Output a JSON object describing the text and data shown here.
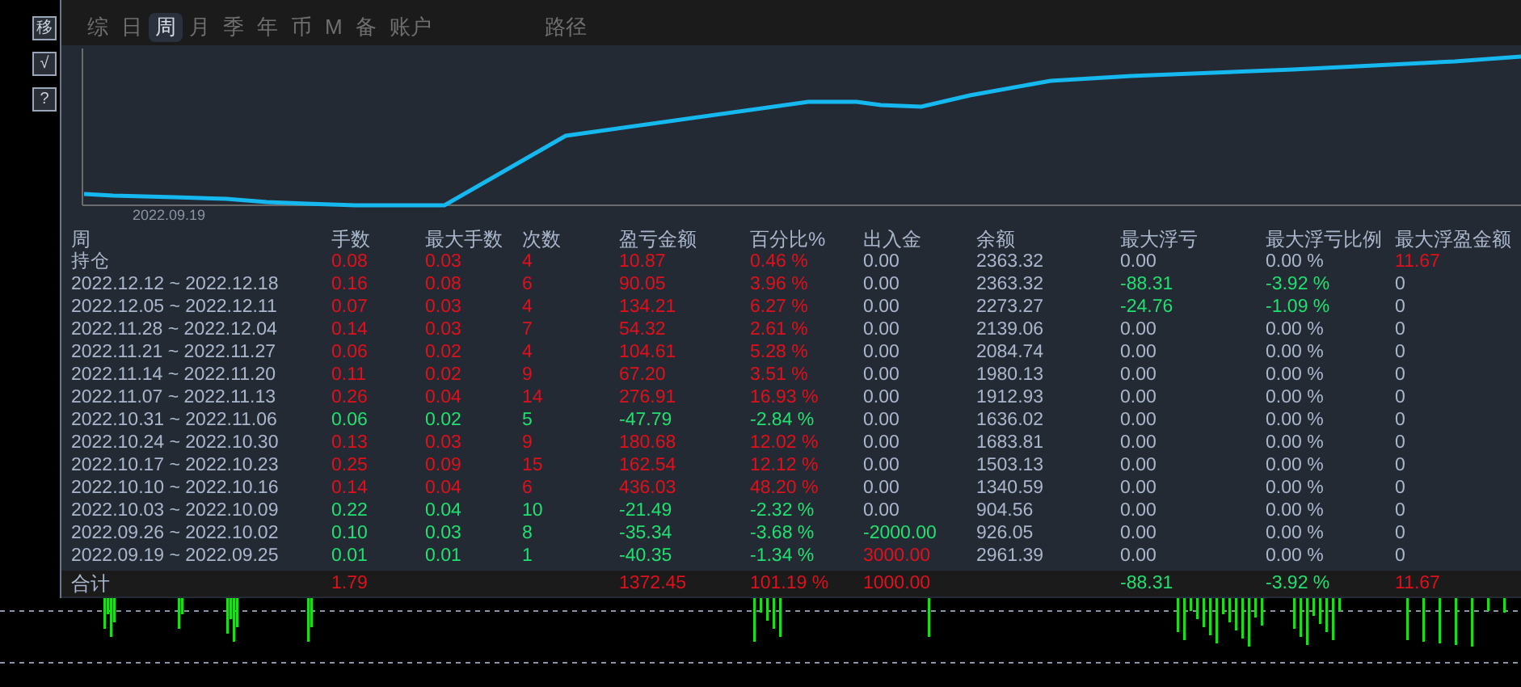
{
  "side_buttons": [
    "移",
    "√",
    "?"
  ],
  "tabs": [
    {
      "label": "综",
      "kind": "view",
      "selected": false
    },
    {
      "label": "日",
      "kind": "view",
      "selected": false
    },
    {
      "label": "周",
      "kind": "view",
      "selected": true
    },
    {
      "label": "月",
      "kind": "view",
      "selected": false
    },
    {
      "label": "季",
      "kind": "view",
      "selected": false
    },
    {
      "label": "年",
      "kind": "view",
      "selected": false
    },
    {
      "label": "币",
      "kind": "view",
      "selected": false
    },
    {
      "label": "M",
      "kind": "view",
      "selected": false
    },
    {
      "label": "备",
      "kind": "view",
      "selected": false
    },
    {
      "label": "账户",
      "kind": "view",
      "selected": false
    },
    {
      "label": "路径",
      "kind": "route",
      "selected": false
    }
  ],
  "equity_chart": {
    "date_label": "2022.09.19"
  },
  "table": {
    "period_header": "周",
    "columns": [
      "手数",
      "最大手数",
      "次数",
      "盈亏金额",
      "百分比%",
      "出入金",
      "余额",
      "最大浮亏",
      "最大浮亏比例",
      "最大浮盈金额"
    ],
    "rows": [
      {
        "period": "持仓",
        "cells": [
          {
            "text": "0.08",
            "color": "#e0101c"
          },
          {
            "text": "0.03",
            "color": "#e0101c"
          },
          {
            "text": "4",
            "color": "#e0101c"
          },
          {
            "text": "10.87",
            "color": "#e0101c"
          },
          {
            "text": "0.46 %",
            "color": "#e0101c"
          },
          {
            "text": "0.00",
            "color": "#a9b6cc"
          },
          {
            "text": "2363.32",
            "color": "#a9b6cc"
          },
          {
            "text": "0.00",
            "color": "#a9b6cc"
          },
          {
            "text": "0.00 %",
            "color": "#a9b6cc"
          },
          {
            "text": "11.67",
            "color": "#e0101c"
          }
        ]
      },
      {
        "period": "2022.12.12 ~ 2022.12.18",
        "cells": [
          {
            "text": "0.16",
            "color": "#e0101c"
          },
          {
            "text": "0.08",
            "color": "#e0101c"
          },
          {
            "text": "6",
            "color": "#e0101c"
          },
          {
            "text": "90.05",
            "color": "#e0101c"
          },
          {
            "text": "3.96 %",
            "color": "#e0101c"
          },
          {
            "text": "0.00",
            "color": "#a9b6cc"
          },
          {
            "text": "2363.32",
            "color": "#a9b6cc"
          },
          {
            "text": "-88.31",
            "color": "#1fe070"
          },
          {
            "text": "-3.92 %",
            "color": "#1fe070"
          },
          {
            "text": "0",
            "color": "#a9b6cc"
          }
        ]
      },
      {
        "period": "2022.12.05 ~ 2022.12.11",
        "cells": [
          {
            "text": "0.07",
            "color": "#e0101c"
          },
          {
            "text": "0.03",
            "color": "#e0101c"
          },
          {
            "text": "4",
            "color": "#e0101c"
          },
          {
            "text": "134.21",
            "color": "#e0101c"
          },
          {
            "text": "6.27 %",
            "color": "#e0101c"
          },
          {
            "text": "0.00",
            "color": "#a9b6cc"
          },
          {
            "text": "2273.27",
            "color": "#a9b6cc"
          },
          {
            "text": "-24.76",
            "color": "#1fe070"
          },
          {
            "text": "-1.09 %",
            "color": "#1fe070"
          },
          {
            "text": "0",
            "color": "#a9b6cc"
          }
        ]
      },
      {
        "period": "2022.11.28 ~ 2022.12.04",
        "cells": [
          {
            "text": "0.14",
            "color": "#e0101c"
          },
          {
            "text": "0.03",
            "color": "#e0101c"
          },
          {
            "text": "7",
            "color": "#e0101c"
          },
          {
            "text": "54.32",
            "color": "#e0101c"
          },
          {
            "text": "2.61 %",
            "color": "#e0101c"
          },
          {
            "text": "0.00",
            "color": "#a9b6cc"
          },
          {
            "text": "2139.06",
            "color": "#a9b6cc"
          },
          {
            "text": "0.00",
            "color": "#a9b6cc"
          },
          {
            "text": "0.00 %",
            "color": "#a9b6cc"
          },
          {
            "text": "0",
            "color": "#a9b6cc"
          }
        ]
      },
      {
        "period": "2022.11.21 ~ 2022.11.27",
        "cells": [
          {
            "text": "0.06",
            "color": "#e0101c"
          },
          {
            "text": "0.02",
            "color": "#e0101c"
          },
          {
            "text": "4",
            "color": "#e0101c"
          },
          {
            "text": "104.61",
            "color": "#e0101c"
          },
          {
            "text": "5.28 %",
            "color": "#e0101c"
          },
          {
            "text": "0.00",
            "color": "#a9b6cc"
          },
          {
            "text": "2084.74",
            "color": "#a9b6cc"
          },
          {
            "text": "0.00",
            "color": "#a9b6cc"
          },
          {
            "text": "0.00 %",
            "color": "#a9b6cc"
          },
          {
            "text": "0",
            "color": "#a9b6cc"
          }
        ]
      },
      {
        "period": "2022.11.14 ~ 2022.11.20",
        "cells": [
          {
            "text": "0.11",
            "color": "#e0101c"
          },
          {
            "text": "0.02",
            "color": "#e0101c"
          },
          {
            "text": "9",
            "color": "#e0101c"
          },
          {
            "text": "67.20",
            "color": "#e0101c"
          },
          {
            "text": "3.51 %",
            "color": "#e0101c"
          },
          {
            "text": "0.00",
            "color": "#a9b6cc"
          },
          {
            "text": "1980.13",
            "color": "#a9b6cc"
          },
          {
            "text": "0.00",
            "color": "#a9b6cc"
          },
          {
            "text": "0.00 %",
            "color": "#a9b6cc"
          },
          {
            "text": "0",
            "color": "#a9b6cc"
          }
        ]
      },
      {
        "period": "2022.11.07 ~ 2022.11.13",
        "cells": [
          {
            "text": "0.26",
            "color": "#e0101c"
          },
          {
            "text": "0.04",
            "color": "#e0101c"
          },
          {
            "text": "14",
            "color": "#e0101c"
          },
          {
            "text": "276.91",
            "color": "#e0101c"
          },
          {
            "text": "16.93 %",
            "color": "#e0101c"
          },
          {
            "text": "0.00",
            "color": "#a9b6cc"
          },
          {
            "text": "1912.93",
            "color": "#a9b6cc"
          },
          {
            "text": "0.00",
            "color": "#a9b6cc"
          },
          {
            "text": "0.00 %",
            "color": "#a9b6cc"
          },
          {
            "text": "0",
            "color": "#a9b6cc"
          }
        ]
      },
      {
        "period": "2022.10.31 ~ 2022.11.06",
        "cells": [
          {
            "text": "0.06",
            "color": "#1fe070"
          },
          {
            "text": "0.02",
            "color": "#1fe070"
          },
          {
            "text": "5",
            "color": "#1fe070"
          },
          {
            "text": "-47.79",
            "color": "#1fe070"
          },
          {
            "text": "-2.84 %",
            "color": "#1fe070"
          },
          {
            "text": "0.00",
            "color": "#a9b6cc"
          },
          {
            "text": "1636.02",
            "color": "#a9b6cc"
          },
          {
            "text": "0.00",
            "color": "#a9b6cc"
          },
          {
            "text": "0.00 %",
            "color": "#a9b6cc"
          },
          {
            "text": "0",
            "color": "#a9b6cc"
          }
        ]
      },
      {
        "period": "2022.10.24 ~ 2022.10.30",
        "cells": [
          {
            "text": "0.13",
            "color": "#e0101c"
          },
          {
            "text": "0.03",
            "color": "#e0101c"
          },
          {
            "text": "9",
            "color": "#e0101c"
          },
          {
            "text": "180.68",
            "color": "#e0101c"
          },
          {
            "text": "12.02 %",
            "color": "#e0101c"
          },
          {
            "text": "0.00",
            "color": "#a9b6cc"
          },
          {
            "text": "1683.81",
            "color": "#a9b6cc"
          },
          {
            "text": "0.00",
            "color": "#a9b6cc"
          },
          {
            "text": "0.00 %",
            "color": "#a9b6cc"
          },
          {
            "text": "0",
            "color": "#a9b6cc"
          }
        ]
      },
      {
        "period": "2022.10.17 ~ 2022.10.23",
        "cells": [
          {
            "text": "0.25",
            "color": "#e0101c"
          },
          {
            "text": "0.09",
            "color": "#e0101c"
          },
          {
            "text": "15",
            "color": "#e0101c"
          },
          {
            "text": "162.54",
            "color": "#e0101c"
          },
          {
            "text": "12.12 %",
            "color": "#e0101c"
          },
          {
            "text": "0.00",
            "color": "#a9b6cc"
          },
          {
            "text": "1503.13",
            "color": "#a9b6cc"
          },
          {
            "text": "0.00",
            "color": "#a9b6cc"
          },
          {
            "text": "0.00 %",
            "color": "#a9b6cc"
          },
          {
            "text": "0",
            "color": "#a9b6cc"
          }
        ]
      },
      {
        "period": "2022.10.10 ~ 2022.10.16",
        "cells": [
          {
            "text": "0.14",
            "color": "#e0101c"
          },
          {
            "text": "0.04",
            "color": "#e0101c"
          },
          {
            "text": "6",
            "color": "#e0101c"
          },
          {
            "text": "436.03",
            "color": "#e0101c"
          },
          {
            "text": "48.20 %",
            "color": "#e0101c"
          },
          {
            "text": "0.00",
            "color": "#a9b6cc"
          },
          {
            "text": "1340.59",
            "color": "#a9b6cc"
          },
          {
            "text": "0.00",
            "color": "#a9b6cc"
          },
          {
            "text": "0.00 %",
            "color": "#a9b6cc"
          },
          {
            "text": "0",
            "color": "#a9b6cc"
          }
        ]
      },
      {
        "period": "2022.10.03 ~ 2022.10.09",
        "cells": [
          {
            "text": "0.22",
            "color": "#1fe070"
          },
          {
            "text": "0.04",
            "color": "#1fe070"
          },
          {
            "text": "10",
            "color": "#1fe070"
          },
          {
            "text": "-21.49",
            "color": "#1fe070"
          },
          {
            "text": "-2.32 %",
            "color": "#1fe070"
          },
          {
            "text": "0.00",
            "color": "#a9b6cc"
          },
          {
            "text": "904.56",
            "color": "#a9b6cc"
          },
          {
            "text": "0.00",
            "color": "#a9b6cc"
          },
          {
            "text": "0.00 %",
            "color": "#a9b6cc"
          },
          {
            "text": "0",
            "color": "#a9b6cc"
          }
        ]
      },
      {
        "period": "2022.09.26 ~ 2022.10.02",
        "cells": [
          {
            "text": "0.10",
            "color": "#1fe070"
          },
          {
            "text": "0.03",
            "color": "#1fe070"
          },
          {
            "text": "8",
            "color": "#1fe070"
          },
          {
            "text": "-35.34",
            "color": "#1fe070"
          },
          {
            "text": "-3.68 %",
            "color": "#1fe070"
          },
          {
            "text": "-2000.00",
            "color": "#1fe070"
          },
          {
            "text": "926.05",
            "color": "#a9b6cc"
          },
          {
            "text": "0.00",
            "color": "#a9b6cc"
          },
          {
            "text": "0.00 %",
            "color": "#a9b6cc"
          },
          {
            "text": "0",
            "color": "#a9b6cc"
          }
        ]
      },
      {
        "period": "2022.09.19 ~ 2022.09.25",
        "cells": [
          {
            "text": "0.01",
            "color": "#1fe070"
          },
          {
            "text": "0.01",
            "color": "#1fe070"
          },
          {
            "text": "1",
            "color": "#1fe070"
          },
          {
            "text": "-40.35",
            "color": "#1fe070"
          },
          {
            "text": "-1.34 %",
            "color": "#1fe070"
          },
          {
            "text": "3000.00",
            "color": "#e0101c"
          },
          {
            "text": "2961.39",
            "color": "#a9b6cc"
          },
          {
            "text": "0.00",
            "color": "#a9b6cc"
          },
          {
            "text": "0.00 %",
            "color": "#a9b6cc"
          },
          {
            "text": "0",
            "color": "#a9b6cc"
          }
        ]
      }
    ],
    "total": {
      "label": "合计",
      "cells": [
        {
          "text": "1.79",
          "color": "#e0101c"
        },
        null,
        null,
        {
          "text": "1372.45",
          "color": "#e0101c"
        },
        {
          "text": "101.19 %",
          "color": "#e0101c"
        },
        {
          "text": "1000.00",
          "color": "#e0101c"
        },
        null,
        {
          "text": "-88.31",
          "color": "#1fe070"
        },
        {
          "text": "-3.92 %",
          "color": "#1fe070"
        },
        {
          "text": "11.67",
          "color": "#e0101c"
        }
      ]
    }
  }
}
